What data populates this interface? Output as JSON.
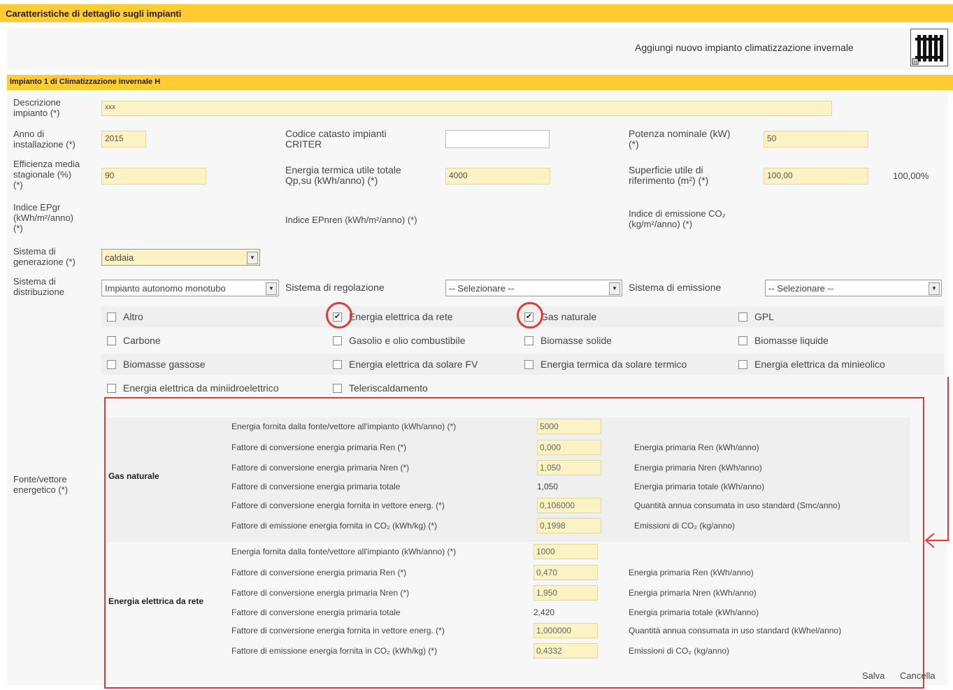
{
  "page": {
    "title": "Caratteristiche di dettaglio sugli impianti",
    "add_button_label": "Aggiungi nuovo impianto climatizzazione invernale"
  },
  "impianto": {
    "title": "Impianto 1 di Climatizzazione invernale H",
    "descrizione": {
      "label_1": "Descrizione",
      "label_2": "impianto (*)",
      "value": "xxx"
    },
    "anno": {
      "label_1": "Anno di",
      "label_2": "installazione (*)",
      "value": "2015"
    },
    "codice_catasto": {
      "label_1": "Codice catasto impianti",
      "label_2": "CRITER",
      "value": ""
    },
    "potenza": {
      "label_1": "Potenza nominale (kW)",
      "label_2": "(*)",
      "value": "50"
    },
    "efficienza": {
      "label_1": "Efficienza media",
      "label_2": "stagionale (%)",
      "label_3": "(*)",
      "value": "90"
    },
    "energia_termica": {
      "label_1": "Energia termica utile totale",
      "label_2": "Qp,su (kWh/anno) (*)",
      "value": "4000"
    },
    "superficie": {
      "label_1": "Superficie utile di",
      "label_2": "riferimento (m²) (*)",
      "value": "100,00",
      "percent": "100,00%"
    },
    "indice_ep": {
      "label_1": "Indice EPgr",
      "label_2": "(kWh/m²/anno)",
      "label_3": "(*)"
    },
    "indice_epnren": {
      "label": "Indice EPnren (kWh/m²/anno) (*)"
    },
    "indice_co2": {
      "label_1": "Indice di emissione CO₂",
      "label_2": "(kg/m²/anno) (*)"
    },
    "sistema_generazione": {
      "label_1": "Sistema di",
      "label_2": "generazione (*)",
      "value": "caldaia"
    },
    "sistema_distribuzione": {
      "label_1": "Sistema di",
      "label_2": "distribuzione",
      "value": "Impianto autonomo monotubo"
    },
    "sistema_regolazione": {
      "label": "Sistema di regolazione",
      "value": "-- Selezionare --"
    },
    "sistema_emissione": {
      "label": "Sistema di emissione",
      "value": "-- Selezionare --"
    },
    "fonte_label_1": "Fonte/vettore",
    "fonte_label_2": "energetico (*)"
  },
  "fonti": [
    {
      "label": "Altro",
      "checked": false
    },
    {
      "label": "Energia elettrica da rete",
      "checked": true
    },
    {
      "label": "Gas naturale",
      "checked": true
    },
    {
      "label": "GPL",
      "checked": false
    },
    {
      "label": "Carbone",
      "checked": false
    },
    {
      "label": "Gasolio e olio combustibile",
      "checked": false
    },
    {
      "label": "Biomasse solide",
      "checked": false
    },
    {
      "label": "Biomasse liquide",
      "checked": false
    },
    {
      "label": "Biomasse gassose",
      "checked": false
    },
    {
      "label": "Energia elettrica da solare FV",
      "checked": false
    },
    {
      "label": "Energia termica da solare termico",
      "checked": false
    },
    {
      "label": "Energia elettrica da minieolico",
      "checked": false
    },
    {
      "label": "Energia elettrica da miniidroelettrico",
      "checked": false
    },
    {
      "label": "Teleriscaldamento",
      "checked": false
    }
  ],
  "gas": {
    "name": "Gas naturale",
    "rows": [
      {
        "label": "Energia fornita dalla fonte/vettore all'impianto (kWh/anno) (*)",
        "value": "5000",
        "right": ""
      },
      {
        "label": "Fattore di conversione energia primaria Ren (*)",
        "value": "0,000",
        "right": "Energia primaria Ren (kWh/anno)"
      },
      {
        "label": "Fattore di conversione energia primaria Nren (*)",
        "value": "1,050",
        "right": "Energia primaria Nren (kWh/anno)"
      },
      {
        "label": "Fattore di conversione energia primaria totale",
        "value": "1,050",
        "right": "Energia primaria totale (kWh/anno)"
      },
      {
        "label": "Fattore di conversione energia fornita in vettore energ. (*)",
        "value": "0,106000",
        "right": "Quantità annua consumata in uso standard (Smc/anno)"
      },
      {
        "label": "Fattore di emissione energia fornita in CO₂ (kWh/kg) (*)",
        "value": "0,1998",
        "right": "Emissioni di CO₂ (kg/anno)"
      }
    ]
  },
  "elettrica": {
    "name": "Energia elettrica da rete",
    "rows": [
      {
        "label": "Energia fornita dalla fonte/vettore all'impianto (kWh/anno) (*)",
        "value": "1000",
        "right": ""
      },
      {
        "label": "Fattore di conversione energia primaria Ren (*)",
        "value": "0,470",
        "right": "Energia primaria Ren (kWh/anno)"
      },
      {
        "label": "Fattore di conversione energia primaria Nren (*)",
        "value": "1,950",
        "right": "Energia primaria Nren (kWh/anno)"
      },
      {
        "label": "Fattore di conversione energia primaria totale",
        "value": "2,420",
        "right": "Energia primaria totale (kWh/anno)"
      },
      {
        "label": "Fattore di conversione energia fornita in vettore energ. (*)",
        "value": "1,000000",
        "right": "Quantità annua consumata in uso standard (kWhel/anno)"
      },
      {
        "label": "Fattore di emissione energia fornita in CO₂ (kWh/kg) (*)",
        "value": "0,4332",
        "right": "Emissioni di CO₂ (kg/anno)"
      }
    ]
  },
  "actions": {
    "save": "Salva",
    "cancel": "Cancella"
  },
  "colors": {
    "header": "#ffcc33",
    "input_bg": "#fcf3c5",
    "highlight": "#e53935"
  }
}
